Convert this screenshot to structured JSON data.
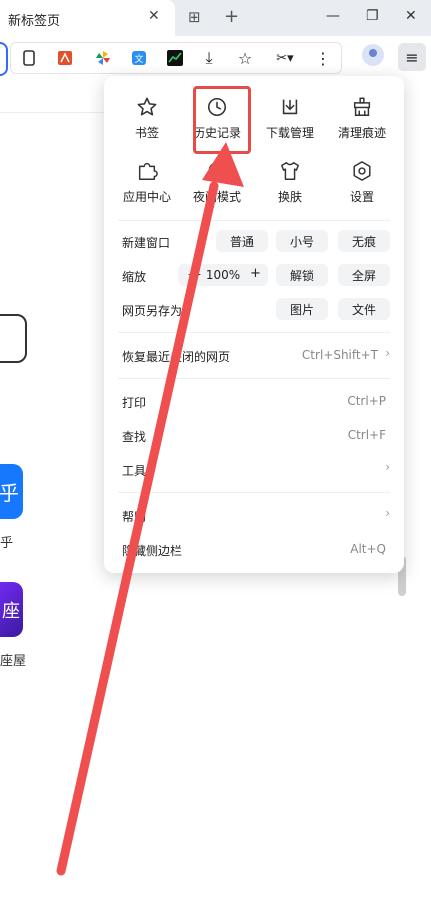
{
  "tab": {
    "title": "新标签页",
    "close": "✕"
  },
  "tabbar_icons": {
    "grid": "⊞",
    "new_tab": "+"
  },
  "window": {
    "minimize": "—",
    "restore": "❐",
    "close": "✕"
  },
  "toolbar": {
    "menu_icon": "≡",
    "download_icon": "⤓",
    "star_icon": "☆",
    "scissors_icon": "✂▾",
    "more_icon": "⋮"
  },
  "page": {
    "zhihu_char": "乎",
    "zhihu_label": "乎",
    "zuo_char": "座",
    "zuo_label": "座屋"
  },
  "menu": {
    "tiles": [
      {
        "label": "书签",
        "icon": "star-icon"
      },
      {
        "label": "历史记录",
        "icon": "clock-icon"
      },
      {
        "label": "下载管理",
        "icon": "download-icon"
      },
      {
        "label": "清理痕迹",
        "icon": "broom-icon"
      },
      {
        "label": "应用中心",
        "icon": "puzzle-icon"
      },
      {
        "label": "夜间模式",
        "icon": "moon-icon"
      },
      {
        "label": "换肤",
        "icon": "shirt-icon"
      },
      {
        "label": "设置",
        "icon": "gear-icon"
      }
    ],
    "new_window": {
      "label": "新建窗口",
      "options": [
        "普通",
        "小号",
        "无痕"
      ]
    },
    "zoom": {
      "label": "缩放",
      "minus": "—",
      "value": "100%",
      "plus": "+",
      "unlock": "解锁",
      "fullscreen": "全屏"
    },
    "save_as": {
      "label": "网页另存为",
      "options": [
        "图片",
        "文件"
      ]
    },
    "restore": {
      "label": "恢复最近关闭的网页",
      "shortcut": "Ctrl+Shift+T",
      "chevron": "›"
    },
    "print": {
      "label": "打印",
      "shortcut": "Ctrl+P"
    },
    "find": {
      "label": "查找",
      "shortcut": "Ctrl+F"
    },
    "tools": {
      "label": "工具",
      "chevron": "›"
    },
    "help": {
      "label": "帮助",
      "chevron": "›"
    },
    "hide_sidebar": {
      "label": "隐藏侧边栏",
      "shortcut": "Alt+Q"
    }
  },
  "colors": {
    "highlight": "#e84a4a",
    "arrow": "#ef4f4f",
    "accent": "#2f6bff"
  }
}
